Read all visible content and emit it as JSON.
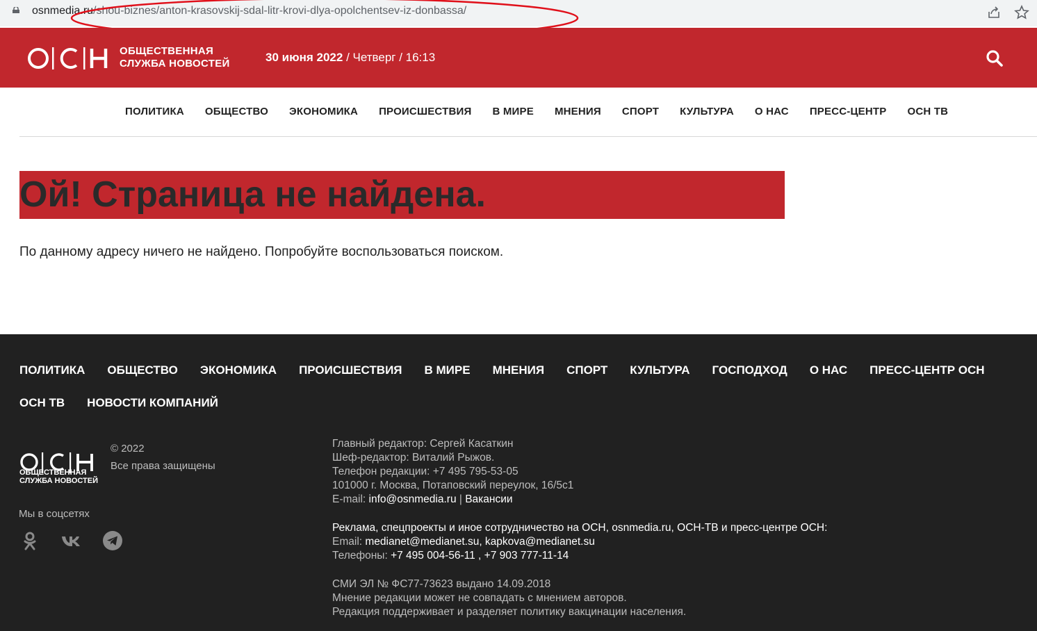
{
  "browser": {
    "url_domain": "osnmedia.ru",
    "url_path": "/shou-biznes/anton-krasovskij-sdal-litr-krovi-dlya-opolchentsev-iz-donbassa/"
  },
  "header": {
    "logo_top": "ОБЩЕСТВЕННАЯ",
    "logo_bottom": "СЛУЖБА НОВОСТЕЙ",
    "date_bold": "30 июня 2022",
    "date_rest": " / Четверг / 16:13"
  },
  "topnav": [
    "ПОЛИТИКА",
    "ОБЩЕСТВО",
    "ЭКОНОМИКА",
    "ПРОИСШЕСТВИЯ",
    "В МИРЕ",
    "МНЕНИЯ",
    "СПОРТ",
    "КУЛЬТУРА",
    "О НАС",
    "ПРЕСС-ЦЕНТР",
    "ОСН ТВ"
  ],
  "error": {
    "title": "Ой! Страница не найдена.",
    "text": "По данному адресу ничего не найдено. Попробуйте воспользоваться поиском."
  },
  "footer": {
    "nav": [
      "ПОЛИТИКА",
      "ОБЩЕСТВО",
      "ЭКОНОМИКА",
      "ПРОИСШЕСТВИЯ",
      "В МИРЕ",
      "МНЕНИЯ",
      "СПОРТ",
      "КУЛЬТУРА",
      "ГОСПОДХОД",
      "О НАС",
      "ПРЕСС-ЦЕНТР ОСН",
      "ОСН ТВ",
      "НОВОСТИ КОМПАНИЙ"
    ],
    "logo_top": "ОБЩЕСТВЕННАЯ",
    "logo_bottom": "СЛУЖБА НОВОСТЕЙ",
    "copyright": "© 2022",
    "rights": "Все права защищены",
    "social_label": "Мы в соцсетях",
    "social_icons": [
      "odnoklassniki-icon",
      "vk-icon",
      "telegram-icon"
    ],
    "editor": "Главный редактор: Сергей Касаткин",
    "chief_editor": "Шеф-редактор: Виталий Рыжов.",
    "phone": "Телефон редакции: +7 495 795-53-05",
    "address": "101000 г. Москва, Потаповский переулок, 16/5с1",
    "email_label": "E-mail: ",
    "email": "info@osnmedia.ru",
    "sep": " | ",
    "vacancies": "Вакансии",
    "ads_title": "Реклама, спецпроекты и иное сотрудничество на ОСН, osnmedia.ru, ОСН-ТВ и пресс-центре ОСН:",
    "ads_email_label": "Email: ",
    "ads_emails": "medianet@medianet.su, kapkova@medianet.su",
    "ads_phones_label": "Телефоны: ",
    "ads_phones": "+7 495 004-56-11 , +7 903 777-11-14",
    "license": "СМИ ЭЛ № ФС77-73623 выдано 14.09.2018",
    "disclaimer": "Мнение редакции может не совпадать с мнением авторов.",
    "vaccination": "Редакция поддерживает и разделяет политику вакцинации населения."
  },
  "colors": {
    "brand_red": "#c1272d",
    "footer_bg": "#212121",
    "annotation_red": "#e0101a"
  }
}
